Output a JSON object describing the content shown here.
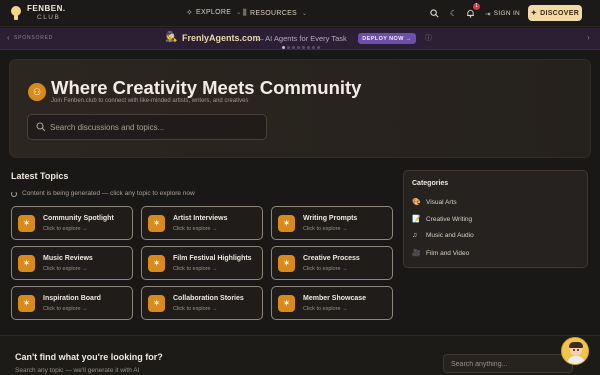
{
  "header": {
    "logo_line1": "FENBEN.",
    "logo_line2": "CLUB",
    "nav": [
      {
        "label": "EXPLORE",
        "icon": "compass-icon"
      },
      {
        "label": "RESOURCES",
        "icon": "library-icon"
      }
    ],
    "notification_count": "1",
    "signin_label": "SIGN IN",
    "discover_label": "DISCOVER"
  },
  "banner": {
    "sponsored_label": "SPONSORED",
    "sponsor_name": "FrenlyAgents.com",
    "sponsor_tagline": "— AI Agents for Every Task",
    "deploy_label": "DEPLOY NOW"
  },
  "hero": {
    "title": "Where Creativity Meets Community",
    "subtitle": "Join Fenben.club to connect with like-minded artists, writers, and creatives",
    "search_placeholder": "Search discussions and topics..."
  },
  "topics": {
    "title": "Latest Topics",
    "generating_text": "Content is being generated — click any topic to explore now",
    "cards": [
      {
        "title": "Community Spotlight",
        "sub": "Click to explore →"
      },
      {
        "title": "Artist Interviews",
        "sub": "Click to explore →"
      },
      {
        "title": "Writing Prompts",
        "sub": "Click to explore →"
      },
      {
        "title": "Music Reviews",
        "sub": "Click to explore →"
      },
      {
        "title": "Film Festival Highlights",
        "sub": "Click to explore →"
      },
      {
        "title": "Creative Process",
        "sub": "Click to explore →"
      },
      {
        "title": "Inspiration Board",
        "sub": "Click to explore →"
      },
      {
        "title": "Collaboration Stories",
        "sub": "Click to explore →"
      },
      {
        "title": "Member Showcase",
        "sub": "Click to explore →"
      }
    ]
  },
  "categories": {
    "title": "Categories",
    "items": [
      {
        "label": "Visual Arts",
        "icon": "palette-icon"
      },
      {
        "label": "Creative Writing",
        "icon": "notepad-icon"
      },
      {
        "label": "Music and Audio",
        "icon": "music-note-icon"
      },
      {
        "label": "Film and Video",
        "icon": "film-camera-icon"
      }
    ]
  },
  "bottom": {
    "title": "Can't find what you're looking for?",
    "subtitle": "Search any topic — we'll generate it with AI",
    "search_placeholder": "Search anything..."
  },
  "colors": {
    "accent_orange": "#d98a1c",
    "discover_bg": "#f3d9a6",
    "banner_bg": "#2a1f33",
    "deploy_bg": "#6b4fa8"
  }
}
